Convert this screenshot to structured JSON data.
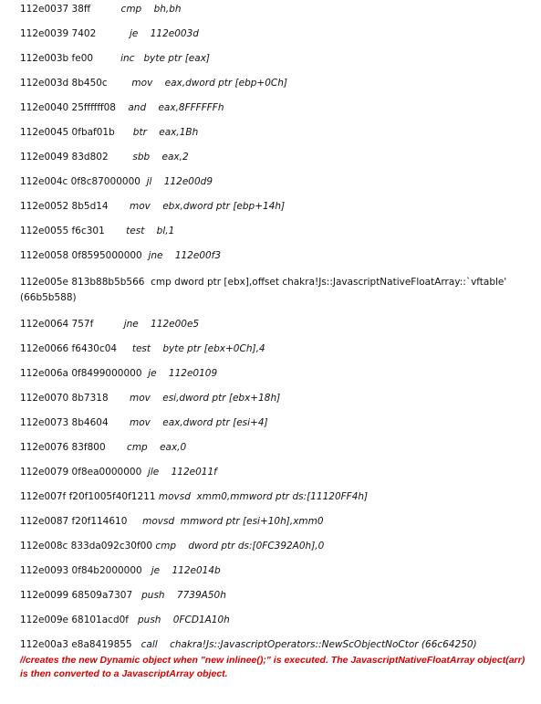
{
  "lines": [
    {
      "addr": "112e0037 38ff",
      "instr": "cmp    bh,bh"
    },
    {
      "addr": "112e0039 7402",
      "instr": "je    112e003d"
    },
    {
      "addr": "112e003b fe00",
      "instr": "inc   byte ptr [eax]"
    },
    {
      "addr": "112e003d 8b450c",
      "instr": "mov    eax,dword ptr [ebp+0Ch]"
    },
    {
      "addr": "112e0040 25ffffff08",
      "instr": "and    eax,8FFFFFFh"
    },
    {
      "addr": "112e0045 0fbaf01b",
      "instr": "btr    eax,1Bh"
    },
    {
      "addr": "112e0049 83d802",
      "instr": "sbb    eax,2"
    },
    {
      "addr": "112e004c 0f8c87000000",
      "instr": "jl    112e00d9"
    },
    {
      "addr": "112e0052 8b5d14",
      "instr": "mov    ebx,dword ptr [ebp+14h]"
    },
    {
      "addr": "112e0055 f6c301",
      "instr": "test    bl,1"
    },
    {
      "addr": "112e0058 0f8595000000",
      "instr": "jne    112e00f3"
    },
    {
      "addr": "112e005e 813b88b5b566",
      "instr": "cmp    dword ptr [ebx],offset chakra!Js::JavascriptNativeFloatArray::`vftable' (66b5b588)"
    },
    {
      "addr": "112e0064 757f",
      "instr": "jne    112e00e5"
    },
    {
      "addr": "112e0066 f6430c04",
      "instr": "test    byte ptr [ebx+0Ch],4"
    },
    {
      "addr": "112e006a 0f8499000000",
      "instr": "je    112e0109"
    },
    {
      "addr": "112e0070 8b7318",
      "instr": "mov    esi,dword ptr [ebx+18h]"
    },
    {
      "addr": "112e0073 8b4604",
      "instr": "mov    eax,dword ptr [esi+4]"
    },
    {
      "addr": "112e0076 83f800",
      "instr": "cmp    eax,0"
    },
    {
      "addr": "112e0079 0f8ea0000000",
      "instr": "jle    112e011f"
    },
    {
      "addr": "112e007f f20f1005f40f1211",
      "instr": "movsd  xmm0,mmword ptr ds:[11120FF4h]"
    },
    {
      "addr": "112e0087 f20f114610",
      "instr": "movsd  mmword ptr [esi+10h],xmm0"
    },
    {
      "addr": "112e008c 833da092c30f00",
      "instr": "cmp    dword ptr ds:[0FC392A0h],0"
    },
    {
      "addr": "112e0093 0f84b2000000",
      "instr": "je    112e014b"
    },
    {
      "addr": "112e0099 68509a7307",
      "instr": "push    7739A50h"
    },
    {
      "addr": "112e009e 68101acd0f",
      "instr": "push    0FCD1A10h"
    },
    {
      "addr": "112e00a3 e8a8419855",
      "instr": "call    chakra!Js::JavascriptOperators::NewScObjectNoCtor (66c64250)"
    }
  ],
  "comment": "//creates the new Dynamic object when \"new inlinee();\" is executed. The JavascriptNativeFloatArray object(arr) is then converted to a JavascriptArray object."
}
